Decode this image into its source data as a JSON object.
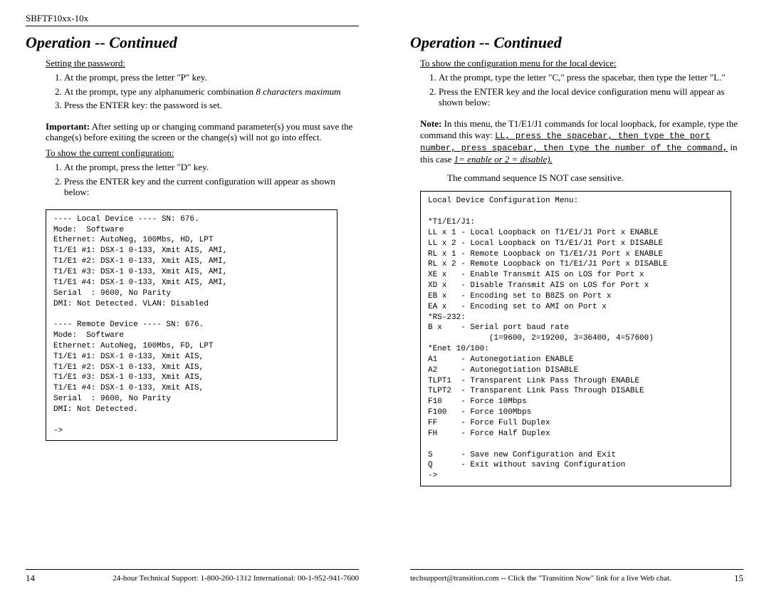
{
  "header": {
    "model": "SBFTF10xx-10x"
  },
  "left": {
    "title": "Operation -- Continued",
    "set_pw_heading": "Setting the password:",
    "set_pw_steps": [
      "At the prompt, press the letter \"P\" key.",
      "At the prompt, type any alphanumeric combination ",
      "Press the ENTER key: the password is set."
    ],
    "set_pw_step2_italic": "8 characters maximum",
    "important_label": "Important:",
    "important_text": " After setting up or changing command parameter(s) you must save the change(s) before exiting the screen or the change(s) will not go into effect.",
    "show_cfg_heading": "To show the current configuration:",
    "show_cfg_steps": [
      "At the prompt, press the letter \"D\" key.",
      "Press the ENTER key and the current configuration will appear as shown below:"
    ],
    "codebox": "---- Local Device ---- SN: 676.\nMode:  Software\nEthernet: AutoNeg, 100Mbs, HD, LPT\nT1/E1 #1: DSX-1 0-133, Xmit AIS, AMI,\nT1/E1 #2: DSX-1 0-133, Xmit AIS, AMI,\nT1/E1 #3: DSX-1 0-133, Xmit AIS, AMI,\nT1/E1 #4: DSX-1 0-133, Xmit AIS, AMI,\nSerial  : 9600, No Parity\nDMI: Not Detected. VLAN: Disabled\n\n---- Remote Device ---- SN: 676.\nMode:  Software\nEthernet: AutoNeg, 100Mbs, FD, LPT\nT1/E1 #1: DSX-1 0-133, Xmit AIS,\nT1/E1 #2: DSX-1 0-133, Xmit AIS,\nT1/E1 #3: DSX-1 0-133, Xmit AIS,\nT1/E1 #4: DSX-1 0-133, Xmit AIS,\nSerial  : 9600, No Parity\nDMI: Not Detected.\n\n->",
    "footer_num": "14",
    "footer_text": "24-hour Technical Support: 1-800-260-1312  International: 00-1-952-941-7600"
  },
  "right": {
    "title": "Operation -- Continued",
    "show_cfg_heading": "To show the configuration menu for the local device:",
    "steps": [
      "At the prompt, type the letter \"C,\" press the spacebar, then type the letter \"L.\"",
      "Press the ENTER key and the local device configuration menu will appear as shown below:"
    ],
    "note_label": "Note:",
    "note_lead": "  In this menu, the T1/E1/J1 commands for local loopback, for example,  type the command this way: ",
    "note_mono1": "LL, press the spacebar, then type the port number, press spacebar, then type the number of the command,",
    "note_tail": "  in this case ",
    "note_enable": "1= enable or 2 = disable).",
    "case_sentence": "The command sequence IS NOT case sensitive.",
    "codebox": "Local Device Configuration Menu:\n\n*T1/E1/J1:\nLL x 1 - Local Loopback on T1/E1/J1 Port x ENABLE\nLL x 2 - Local Loopback on T1/E1/J1 Port x DISABLE\nRL x 1 - Remote Loopback on T1/E1/J1 Port x ENABLE\nRL x 2 - Remote Loopback on T1/E1/J1 Port x DISABLE\nXE x   - Enable Transmit AIS on LOS for Port x\nXD x   - Disable Transmit AIS on LOS for Port x\nEB x   - Encoding set to B8ZS on Port x\nEA x   - Encoding set to AMI on Port x\n*RS-232:\nB x    - Serial port baud rate\n             (1=9600, 2=19200, 3=36400, 4=57600)\n*Enet 10/100:\nA1     - Autonegotiation ENABLE\nA2     - Autonegotiation DISABLE\nTLPT1  - Transparent Link Pass Through ENABLE\nTLPT2  - Transparent Link Pass Through DISABLE\nF10    - Force 10Mbps\nF100   - Force 100Mbps\nFF     - Force Full Duplex\nFH     - Force Half Duplex\n\nS      - Save new Configuration and Exit\nQ      - Exit without saving Configuration\n->",
    "footer_text": "techsupport@transition.com -- Click the \"Transition Now\" link for a live Web chat.",
    "footer_num": "15"
  }
}
